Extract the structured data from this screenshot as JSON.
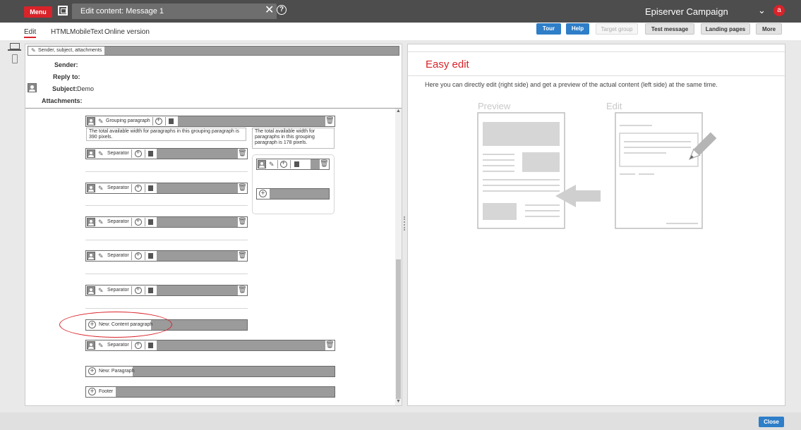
{
  "topbar": {
    "menu_label": "Menu",
    "tab_title": "Edit content: Message 1",
    "app_title": "Episerver Campaign",
    "avatar_letter": "a"
  },
  "toolbar": {
    "links": [
      "Edit",
      "HTML",
      "Mobile",
      "Text",
      "Online version"
    ],
    "buttons": {
      "tour": "Tour",
      "help": "Help",
      "target_group": "Target group",
      "test_message": "Test message",
      "landing_pages": "Landing pages",
      "more": "More"
    }
  },
  "header_section": {
    "bar_label": "Sender, subject, attachments",
    "sender_label": "Sender:",
    "reply_to_label": "Reply to:",
    "subject_label": "Subject:",
    "subject_value": "Demo",
    "attachments_label": "Attachments:"
  },
  "content": {
    "grouping_label": "Grouping paragraph",
    "grouping_left_note": "The total available width for paragraphs in this grouping paragraph is 390 pixels.",
    "grouping_right_note": "The total available width for paragraphs in this grouping paragraph is 178 pixels.",
    "separator_label": "Separator",
    "new_content_paragraph": "New: Content paragraph",
    "new_paragraph": "New: Paragraph",
    "footer": "Footer"
  },
  "easy_edit": {
    "title": "Easy edit",
    "description": "Here you can directly edit (right side) and get a preview of the actual content (left side) at the same time.",
    "preview_label": "Preview",
    "edit_label": "Edit"
  },
  "footer_bar": {
    "close_label": "Close"
  },
  "colors": {
    "accent_red": "#d9232a",
    "button_blue": "#2e7ec8",
    "topbar": "#4d4d4d"
  }
}
